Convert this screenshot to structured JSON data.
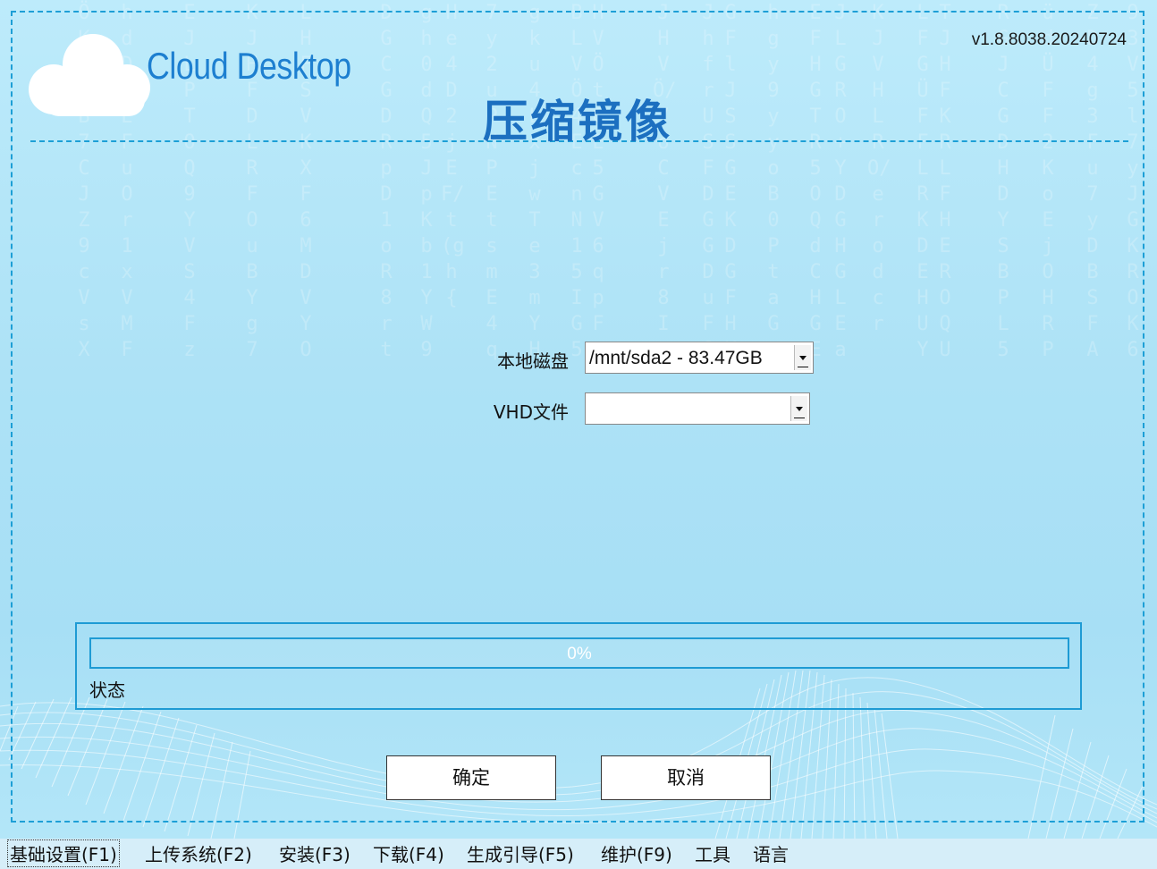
{
  "brand": {
    "logo_text": "Cloud Desktop"
  },
  "version": "v1.8.8038.20240724",
  "page_title": "压缩镜像",
  "form": {
    "local_disk": {
      "label": "本地磁盘",
      "value": "/mnt/sda2 - 83.47GB"
    },
    "vhd_file": {
      "label": "VHD文件",
      "value": ""
    }
  },
  "progress": {
    "percent": 0,
    "text": "0%"
  },
  "status": {
    "label": "状态"
  },
  "buttons": {
    "confirm": "确定",
    "cancel": "取消"
  },
  "menu": [
    {
      "label": "基础设置(F1)"
    },
    {
      "label": "上传系统(F2)"
    },
    {
      "label": "安装(F3)"
    },
    {
      "label": "下载(F4)"
    },
    {
      "label": "生成引导(F5)"
    },
    {
      "label": "维护(F9)"
    },
    {
      "label": "工具"
    },
    {
      "label": "语言"
    }
  ],
  "colors": {
    "accent": "#1e9bd4",
    "title": "#1c6fc0",
    "logo": "#1d7fd0",
    "background": "#ade2f6"
  }
}
